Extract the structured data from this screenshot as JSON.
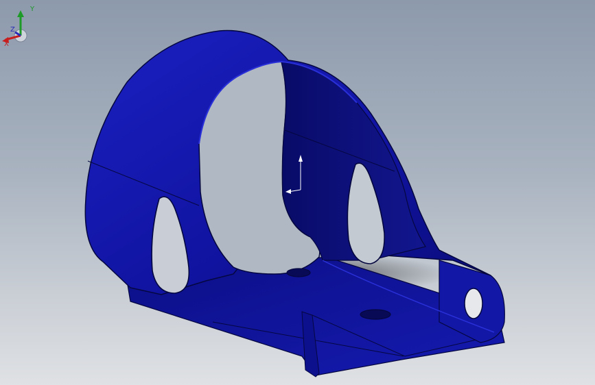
{
  "viewport": {
    "background_top": "#8d9aac",
    "background_bottom": "#dfe1e4",
    "part_color": "#10139a",
    "part_edge_color": "#05073f"
  },
  "triad": {
    "x_label": "X",
    "y_label": "Y",
    "z_label": "Z",
    "x_color": "#c81e1e",
    "y_color": "#1e9a28",
    "z_color": "#2a2ab8"
  },
  "model_origin": {
    "icon": "coordinate-origin-icon"
  }
}
